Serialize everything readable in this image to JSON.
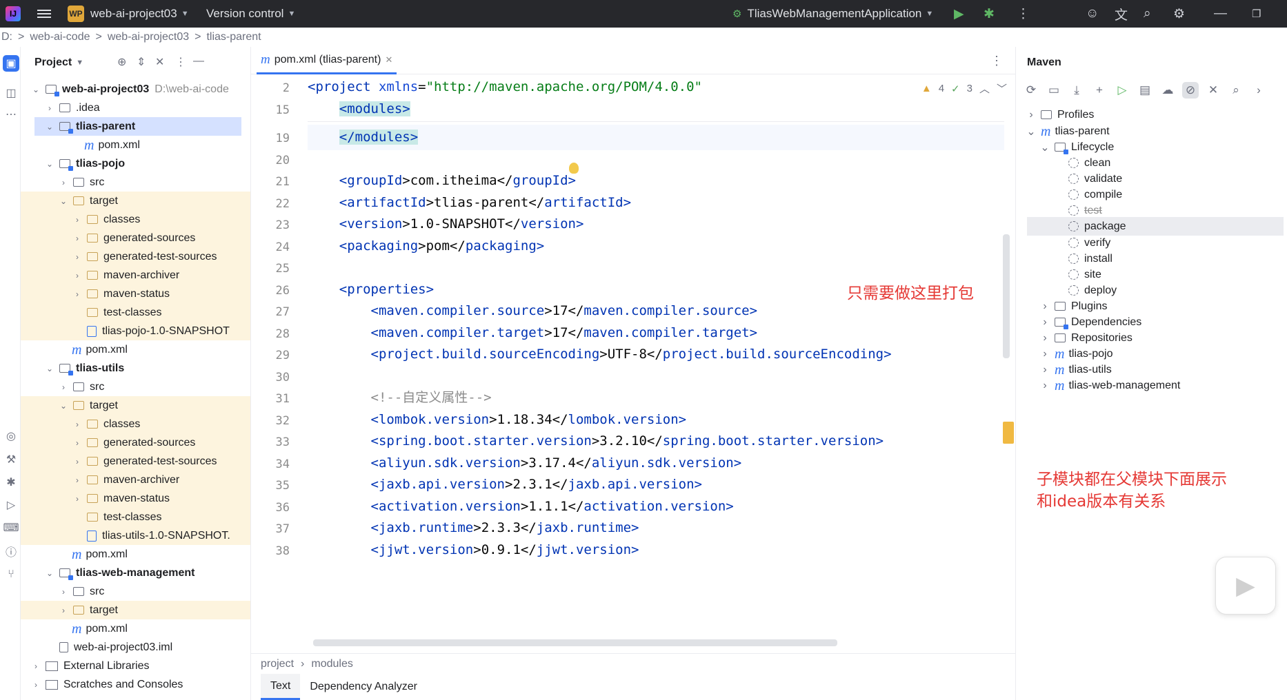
{
  "titlebar": {
    "logo_text": "IJ",
    "project_badge": "WP",
    "project_name": "web-ai-project03",
    "vcs_label": "Version control",
    "run_config": "TliasWebManagementApplication"
  },
  "breadcrumb": [
    "D:",
    ">",
    "web-ai-code",
    ">",
    "web-ai-project03",
    ">",
    "tlias-parent"
  ],
  "project_panel": {
    "title": "Project",
    "tree": [
      {
        "label": "web-ai-project03",
        "extra": "D:\\web-ai-code",
        "bold": true
      },
      {
        "label": ".idea"
      },
      {
        "label": "tlias-parent",
        "bold": true
      },
      {
        "label": "pom.xml"
      },
      {
        "label": "tlias-pojo",
        "bold": true
      },
      {
        "label": "src"
      },
      {
        "label": "target"
      },
      {
        "label": "classes"
      },
      {
        "label": "generated-sources"
      },
      {
        "label": "generated-test-sources"
      },
      {
        "label": "maven-archiver"
      },
      {
        "label": "maven-status"
      },
      {
        "label": "test-classes"
      },
      {
        "label": "tlias-pojo-1.0-SNAPSHOT"
      },
      {
        "label": "pom.xml"
      },
      {
        "label": "tlias-utils",
        "bold": true
      },
      {
        "label": "src"
      },
      {
        "label": "target"
      },
      {
        "label": "classes"
      },
      {
        "label": "generated-sources"
      },
      {
        "label": "generated-test-sources"
      },
      {
        "label": "maven-archiver"
      },
      {
        "label": "maven-status"
      },
      {
        "label": "test-classes"
      },
      {
        "label": "tlias-utils-1.0-SNAPSHOT."
      },
      {
        "label": "pom.xml"
      },
      {
        "label": "tlias-web-management",
        "bold": true
      },
      {
        "label": "src"
      },
      {
        "label": "target"
      },
      {
        "label": "pom.xml"
      },
      {
        "label": "web-ai-project03.iml"
      },
      {
        "label": "External Libraries"
      },
      {
        "label": "Scratches and Consoles"
      }
    ]
  },
  "editor": {
    "tab_label": "pom.xml (tlias-parent)",
    "inspections": {
      "warnings": "4",
      "checks": "3"
    },
    "line_numbers": [
      "2",
      "15",
      "19",
      "20",
      "21",
      "22",
      "23",
      "24",
      "25",
      "26",
      "27",
      "28",
      "29",
      "30",
      "31",
      "32",
      "33",
      "34",
      "35",
      "36",
      "37",
      "38"
    ],
    "annotation": "只需要做这里打包",
    "footer_breadcrumb": [
      "project",
      "modules"
    ],
    "bottom_tabs": [
      "Text",
      "Dependency Analyzer"
    ]
  },
  "code": {
    "l2_open": "<project ",
    "l2_attr": "xmlns",
    "l2_eq": "=",
    "l2_val": "\"http://maven.apache.org/POM/4.0.0\"",
    "l15": "<modules>",
    "l19": "</modules>",
    "l21": [
      "<",
      "groupId",
      ">com.itheima</",
      "groupId",
      ">"
    ],
    "l22": [
      "<",
      "artifactId",
      ">tlias-parent</",
      "artifactId",
      ">"
    ],
    "l23": [
      "<",
      "version",
      ">1.0-SNAPSHOT</",
      "version",
      ">"
    ],
    "l24": [
      "<",
      "packaging",
      ">pom</",
      "packaging",
      ">"
    ],
    "l26": "<properties>",
    "l27": [
      "<",
      "maven.compiler.source",
      ">17</",
      "maven.compiler.source",
      ">"
    ],
    "l28": [
      "<",
      "maven.compiler.target",
      ">17</",
      "maven.compiler.target",
      ">"
    ],
    "l29": [
      "<",
      "project.build.sourceEncoding",
      ">UTF-8</",
      "project.build.sourceEncoding",
      ">"
    ],
    "l31": "<!--自定义属性-->",
    "l32": [
      "<",
      "lombok.version",
      ">1.18.34</",
      "lombok.version",
      ">"
    ],
    "l33": [
      "<",
      "spring.boot.starter.version",
      ">3.2.10</",
      "spring.boot.starter.version",
      ">"
    ],
    "l34": [
      "<",
      "aliyun.sdk.version",
      ">3.17.4</",
      "aliyun.sdk.version",
      ">"
    ],
    "l35": [
      "<",
      "jaxb.api.version",
      ">2.3.1</",
      "jaxb.api.version",
      ">"
    ],
    "l36": [
      "<",
      "activation.version",
      ">1.1.1</",
      "activation.version",
      ">"
    ],
    "l37": [
      "<",
      "jaxb.runtime",
      ">2.3.3</",
      "jaxb.runtime",
      ">"
    ],
    "l38": [
      "<",
      "jjwt.version",
      ">0.9.1</",
      "jjwt.version",
      ">"
    ]
  },
  "maven": {
    "title": "Maven",
    "tree": [
      {
        "label": "Profiles"
      },
      {
        "label": "tlias-parent"
      },
      {
        "label": "Lifecycle"
      },
      {
        "label": "clean"
      },
      {
        "label": "validate"
      },
      {
        "label": "compile"
      },
      {
        "label": "test"
      },
      {
        "label": "package"
      },
      {
        "label": "verify"
      },
      {
        "label": "install"
      },
      {
        "label": "site"
      },
      {
        "label": "deploy"
      },
      {
        "label": "Plugins"
      },
      {
        "label": "Dependencies"
      },
      {
        "label": "Repositories"
      },
      {
        "label": "tlias-pojo"
      },
      {
        "label": "tlias-utils"
      },
      {
        "label": "tlias-web-management"
      }
    ],
    "annotation_line1": "子模块都在父模块下面展示",
    "annotation_line2": "和idea版本有关系"
  }
}
